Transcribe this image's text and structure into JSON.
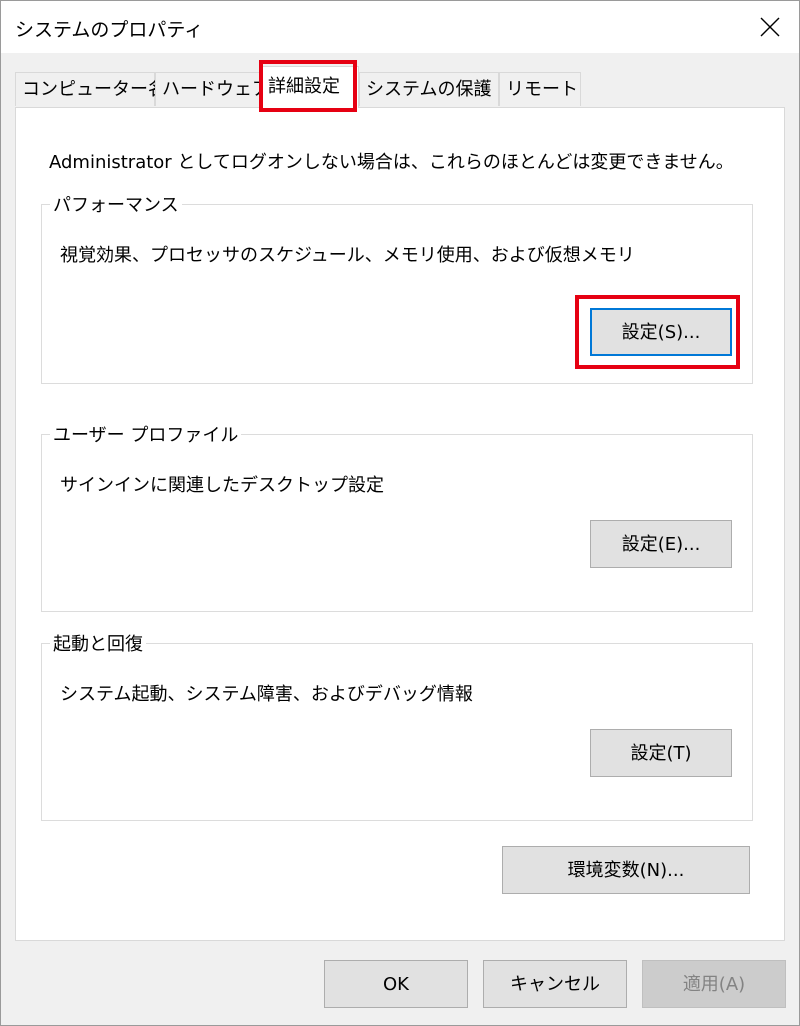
{
  "window": {
    "title": "システムのプロパティ"
  },
  "tabs": [
    {
      "label": "コンピューター名"
    },
    {
      "label": "ハードウェア"
    },
    {
      "label": "詳細設定"
    },
    {
      "label": "システムの保護"
    },
    {
      "label": "リモート"
    }
  ],
  "active_tab": "詳細設定",
  "notice": "Administrator としてログオンしない場合は、これらのほとんどは変更できません。",
  "groups": {
    "performance": {
      "label": "パフォーマンス",
      "description": "視覚効果、プロセッサのスケジュール、メモリ使用、および仮想メモリ",
      "button": "設定(S)..."
    },
    "user_profiles": {
      "label": "ユーザー プロファイル",
      "description": "サインインに関連したデスクトップ設定",
      "button": "設定(E)..."
    },
    "startup_recovery": {
      "label": "起動と回復",
      "description": "システム起動、システム障害、およびデバッグ情報",
      "button": "設定(T)"
    }
  },
  "env_button": "環境変数(N)...",
  "footer": {
    "ok": "OK",
    "cancel": "キャンセル",
    "apply": "適用(A)"
  },
  "colors": {
    "highlight": "#e60012",
    "focus_border": "#0078d7"
  }
}
